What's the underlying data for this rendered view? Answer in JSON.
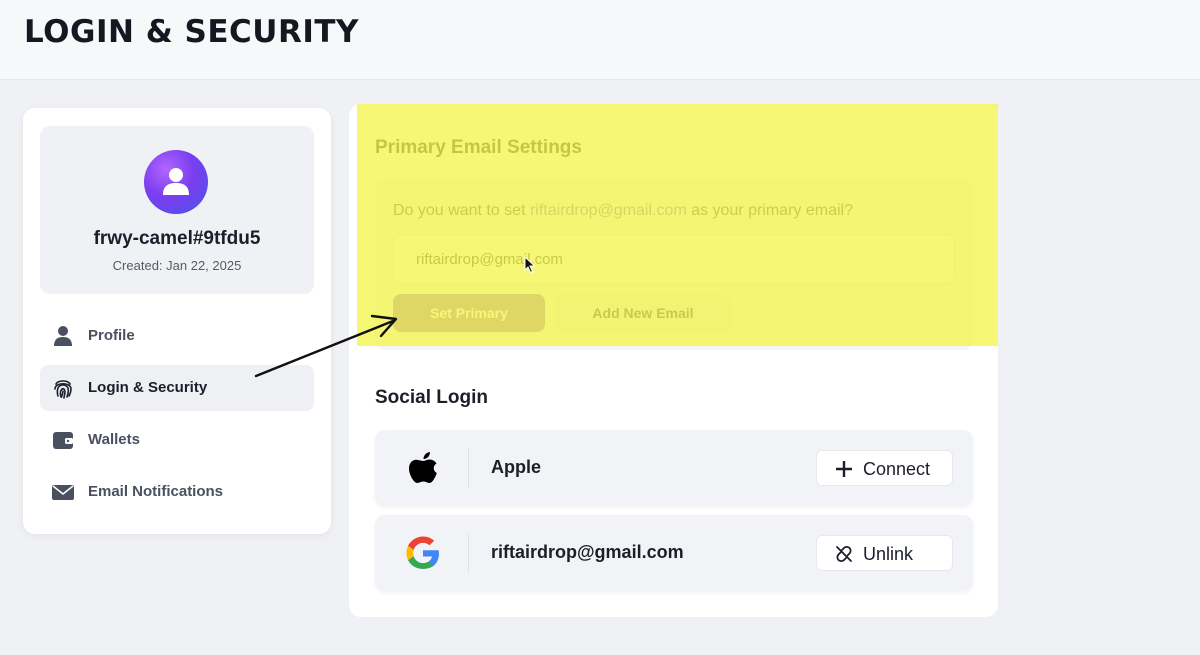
{
  "header": {
    "title": "LOGIN & SECURITY"
  },
  "profile": {
    "username": "frwy-camel#9tfdu5",
    "created": "Created: Jan 22, 2025"
  },
  "sidebar": {
    "items": [
      {
        "label": "Profile",
        "icon": "person-icon"
      },
      {
        "label": "Login & Security",
        "icon": "fingerprint-icon",
        "active": true
      },
      {
        "label": "Wallets",
        "icon": "wallet-icon"
      },
      {
        "label": "Email Notifications",
        "icon": "envelope-icon"
      }
    ]
  },
  "primary_email": {
    "title": "Primary Email Settings",
    "question_prefix": "Do you want to set",
    "question_email": "riftairdrop@gmail.com",
    "question_suffix": "as your primary email?",
    "input_value": "riftairdrop@gmail.com",
    "set_primary_label": "Set Primary",
    "add_email_label": "Add New Email"
  },
  "social_login": {
    "title": "Social Login",
    "rows": [
      {
        "provider": "Apple",
        "button_label": "Connect",
        "button_icon": "plus-icon"
      },
      {
        "provider": "riftairdrop@gmail.com",
        "button_label": "Unlink",
        "button_icon": "unlink-icon"
      }
    ]
  },
  "colors": {
    "accent": "#8f6fb5",
    "highlight": "#f5f550",
    "background": "#f0f1f4"
  }
}
